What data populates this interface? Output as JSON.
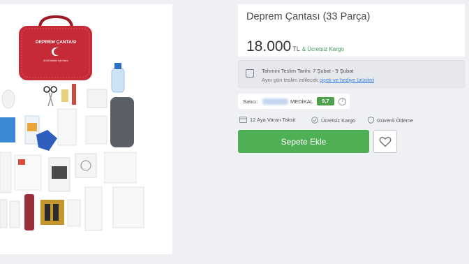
{
  "product": {
    "title": "Deprem Çantası (33 Parça)",
    "price": "18.000",
    "currency": "TL",
    "free_cargo": "& Ücretsiz Kargo",
    "bag_text": "DEPREM ÇANTASI",
    "bag_subtext": "AFAD Afetler İçin Hazır"
  },
  "delivery": {
    "estimate": "Tahmini Teslim Tarihi: 7 Şubat - 9 Şubat",
    "note_prefix": "Aynı gün teslim edilecek",
    "note_link": "çiçek ve hediye ürünleri"
  },
  "seller": {
    "label": "Satıcı:",
    "name": "MEDİKAL",
    "score": "9,7",
    "help": "?"
  },
  "features": [
    "12 Aya Varan Taksit",
    "Ücretsiz Kargo",
    "Güvenli Ödeme"
  ],
  "actions": {
    "add_to_cart": "Sepete Ekle"
  },
  "colors": {
    "accent_green": "#4eaf54",
    "bag_red": "#c62a36",
    "score_green": "#4fa04c"
  }
}
